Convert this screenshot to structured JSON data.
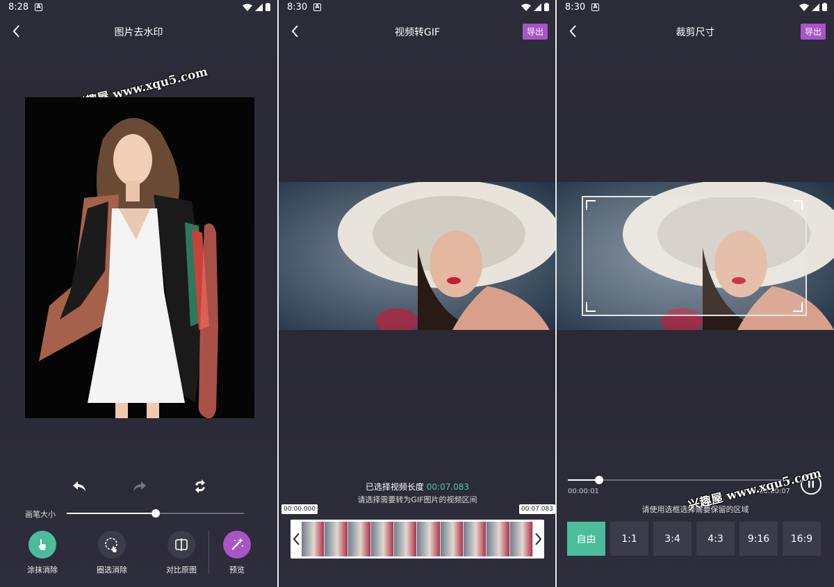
{
  "status_bars": [
    {
      "time": "8:28",
      "notif": "A"
    },
    {
      "time": "8:30",
      "notif": "A"
    },
    {
      "time": "8:30",
      "notif": "A"
    }
  ],
  "watermark": "兴趣屋 www.xqu5.com",
  "panel1": {
    "title": "图片去水印",
    "brush_label": "画笔大小",
    "brush_level": 0.5,
    "actions": [
      {
        "label": "涂抹消除",
        "icon": "finger-touch-icon"
      },
      {
        "label": "圈选消除",
        "icon": "lasso-select-icon"
      },
      {
        "label": "对比原图",
        "icon": "compare-icon"
      },
      {
        "label": "预览",
        "icon": "magic-wand-icon"
      }
    ]
  },
  "panel2": {
    "title": "视频转GIF",
    "export_label": "导出",
    "selected_prefix": "已选择视频长度",
    "selected_value": "00:07.083",
    "hint": "请选择需要转为GIF图片的视频区间",
    "start_tag": "00:00.000",
    "end_tag": "00:07.083"
  },
  "panel3": {
    "title": "裁剪尺寸",
    "export_label": "导出",
    "current_time": "00:00:01",
    "total_time": "00:00:07",
    "progress": 0.14,
    "hint": "请使用选框选择需要保留的区域",
    "ratios": [
      "自由",
      "1:1",
      "3:4",
      "4:3",
      "9:16",
      "16:9"
    ],
    "active_ratio": "自由"
  },
  "colors": {
    "accent_green": "#4bbd9c",
    "accent_purple": "#a855c7",
    "background": "#2b2a37"
  }
}
